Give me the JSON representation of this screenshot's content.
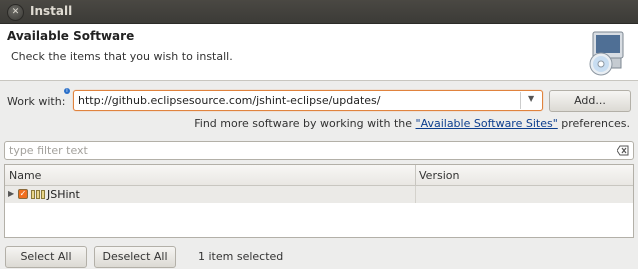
{
  "window": {
    "title": "Install",
    "close_glyph": "✕"
  },
  "header": {
    "title": "Available Software",
    "description": "Check the items that you wish to install.",
    "icon": "install-cd-icon"
  },
  "work_with": {
    "label": "Work with:",
    "value": "http://github.eclipsesource.com/jshint-eclipse/updates/",
    "add_label": "Add..."
  },
  "find_more": {
    "prefix": "Find more software by working with the ",
    "link": "\"Available Software Sites\"",
    "suffix": " preferences."
  },
  "filter": {
    "placeholder": "type filter text"
  },
  "table": {
    "columns": [
      "Name",
      "Version"
    ],
    "rows": [
      {
        "name": "JSHint",
        "version": "",
        "checked": true
      }
    ]
  },
  "footer": {
    "select_all": "Select All",
    "deselect_all": "Deselect All",
    "status": "1 item selected"
  },
  "colors": {
    "accent": "#f06e1e",
    "link": "#0c3e8e",
    "titlebar": "#3c3b37"
  }
}
